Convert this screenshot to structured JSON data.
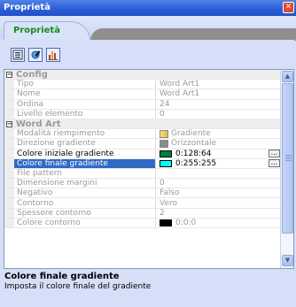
{
  "window": {
    "title": "Proprietà",
    "close_label": "✕"
  },
  "tab": {
    "label": "Proprietà"
  },
  "toolbar": {
    "buttons": [
      "categorized-icon",
      "properties-icon",
      "chart-icon"
    ]
  },
  "grid": {
    "rows": [
      {
        "type": "category",
        "label": "Config",
        "expander": "−"
      },
      {
        "type": "prop",
        "name": "Tipo",
        "value": "Word Art1"
      },
      {
        "type": "prop",
        "name": "Nome",
        "value": "Word Art1"
      },
      {
        "type": "prop",
        "name": "Ordina",
        "value": "24"
      },
      {
        "type": "prop",
        "name": "Livello elemento",
        "value": "0"
      },
      {
        "type": "category",
        "label": "Word Art",
        "expander": "−"
      },
      {
        "type": "prop",
        "name": "Modalità riempimento",
        "value": "Gradiente"
      },
      {
        "type": "prop",
        "name": "Direzione gradiente",
        "value": "Orizzontale"
      },
      {
        "type": "prop",
        "name": "Colore iniziale gradiente",
        "value": "0:128:64",
        "swatch": "#008040"
      },
      {
        "type": "prop",
        "name": "Colore finale gradiente",
        "value": "0:255:255",
        "swatch": "#00ffff"
      },
      {
        "type": "prop",
        "name": "File pattern",
        "value": ""
      },
      {
        "type": "prop",
        "name": "Dimensione margini",
        "value": "0"
      },
      {
        "type": "prop",
        "name": "Negativo",
        "value": "Falso"
      },
      {
        "type": "prop",
        "name": "Contorno",
        "value": "Vero"
      },
      {
        "type": "prop",
        "name": "Spessore contorno",
        "value": "2"
      },
      {
        "type": "prop",
        "name": "Colore contorno",
        "value": "0:0:0",
        "swatch": "#000000"
      }
    ],
    "ellipsis": "..."
  },
  "description": {
    "title": "Colore finale gradiente",
    "text": "Imposta il colore finale del gradiente"
  },
  "colors": {
    "selection": "#3169c6",
    "titlebar": "#2b5bd6",
    "tab_text": "#1a8a1a"
  }
}
